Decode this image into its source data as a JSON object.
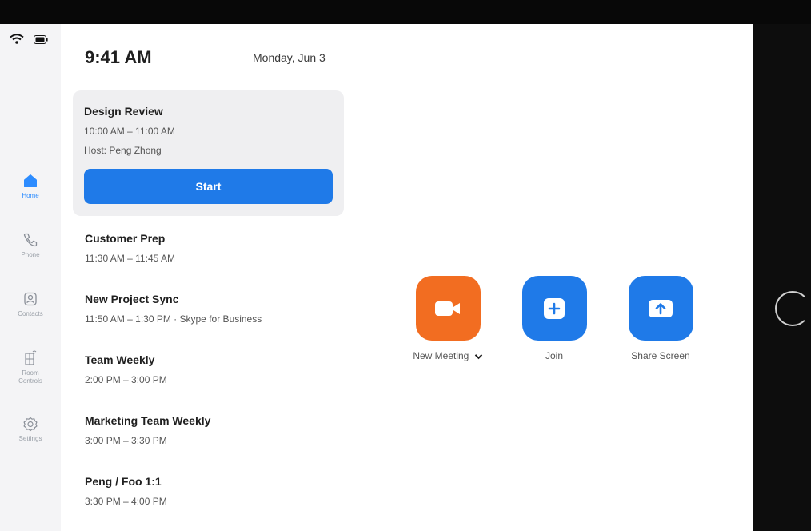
{
  "clock": {
    "time": "9:41 AM",
    "date": "Monday, Jun 3"
  },
  "sidebar": {
    "items": [
      {
        "label": "Home",
        "icon": "home-icon",
        "active": true
      },
      {
        "label": "Phone",
        "icon": "phone-icon",
        "active": false
      },
      {
        "label": "Contacts",
        "icon": "contacts-icon",
        "active": false
      },
      {
        "label": "Room Controls",
        "icon": "room-controls-icon",
        "active": false
      },
      {
        "label": "Settings",
        "icon": "settings-icon",
        "active": false
      }
    ]
  },
  "next_meeting": {
    "title": "Design Review",
    "time": "10:00 AM – 11:00 AM",
    "host": "Host: Peng Zhong",
    "start_label": "Start"
  },
  "meetings": [
    {
      "title": "Customer Prep",
      "time": "11:30 AM – 11:45 AM"
    },
    {
      "title": "New Project Sync",
      "time": "11:50 AM – 1:30 PM · Skype for Business"
    },
    {
      "title": "Team Weekly",
      "time": "2:00 PM – 3:00 PM"
    },
    {
      "title": "Marketing Team Weekly",
      "time": "3:00 PM – 3:30 PM"
    },
    {
      "title": "Peng / Foo 1:1",
      "time": "3:30 PM – 4:00 PM"
    }
  ],
  "actions": {
    "new_meeting": "New Meeting",
    "join": "Join",
    "share_screen": "Share Screen"
  },
  "colors": {
    "accent": "#1f7ae8",
    "new_meeting": "#f26d21",
    "sidebar_bg": "#f4f4f6"
  }
}
